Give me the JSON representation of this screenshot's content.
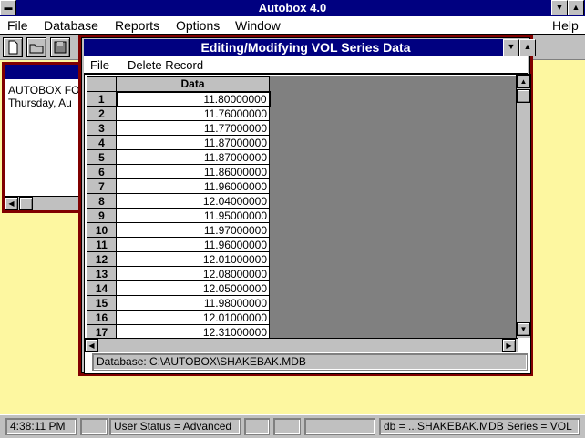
{
  "app": {
    "title": "Autobox 4.0"
  },
  "menu": {
    "file": "File",
    "database": "Database",
    "reports": "Reports",
    "options": "Options",
    "window": "Window",
    "help": "Help"
  },
  "bg_window": {
    "line1": "AUTOBOX FO",
    "line2": "Thursday, Au"
  },
  "editor": {
    "title": "Editing/Modifying VOL Series Data",
    "menu_file": "File",
    "menu_delete": "Delete Record",
    "column_header": "Data",
    "rows": [
      {
        "n": "1",
        "v": "11.80000000"
      },
      {
        "n": "2",
        "v": "11.76000000"
      },
      {
        "n": "3",
        "v": "11.77000000"
      },
      {
        "n": "4",
        "v": "11.87000000"
      },
      {
        "n": "5",
        "v": "11.87000000"
      },
      {
        "n": "6",
        "v": "11.86000000"
      },
      {
        "n": "7",
        "v": "11.96000000"
      },
      {
        "n": "8",
        "v": "12.04000000"
      },
      {
        "n": "9",
        "v": "11.95000000"
      },
      {
        "n": "10",
        "v": "11.97000000"
      },
      {
        "n": "11",
        "v": "11.96000000"
      },
      {
        "n": "12",
        "v": "12.01000000"
      },
      {
        "n": "13",
        "v": "12.08000000"
      },
      {
        "n": "14",
        "v": "12.05000000"
      },
      {
        "n": "15",
        "v": "11.98000000"
      },
      {
        "n": "16",
        "v": "12.01000000"
      },
      {
        "n": "17",
        "v": "12.31000000"
      }
    ],
    "database_path": "Database: C:\\AUTOBOX\\SHAKEBAK.MDB"
  },
  "status": {
    "time": "4:38:11 PM",
    "user_status": "User Status = Advanced",
    "db_series": "db = ...SHAKEBAK.MDB Series = VOL"
  },
  "colors": {
    "title_bar": "#000080",
    "desktop": "#fdf7a0",
    "window_border": "#800000",
    "face": "#c0c0c0"
  }
}
